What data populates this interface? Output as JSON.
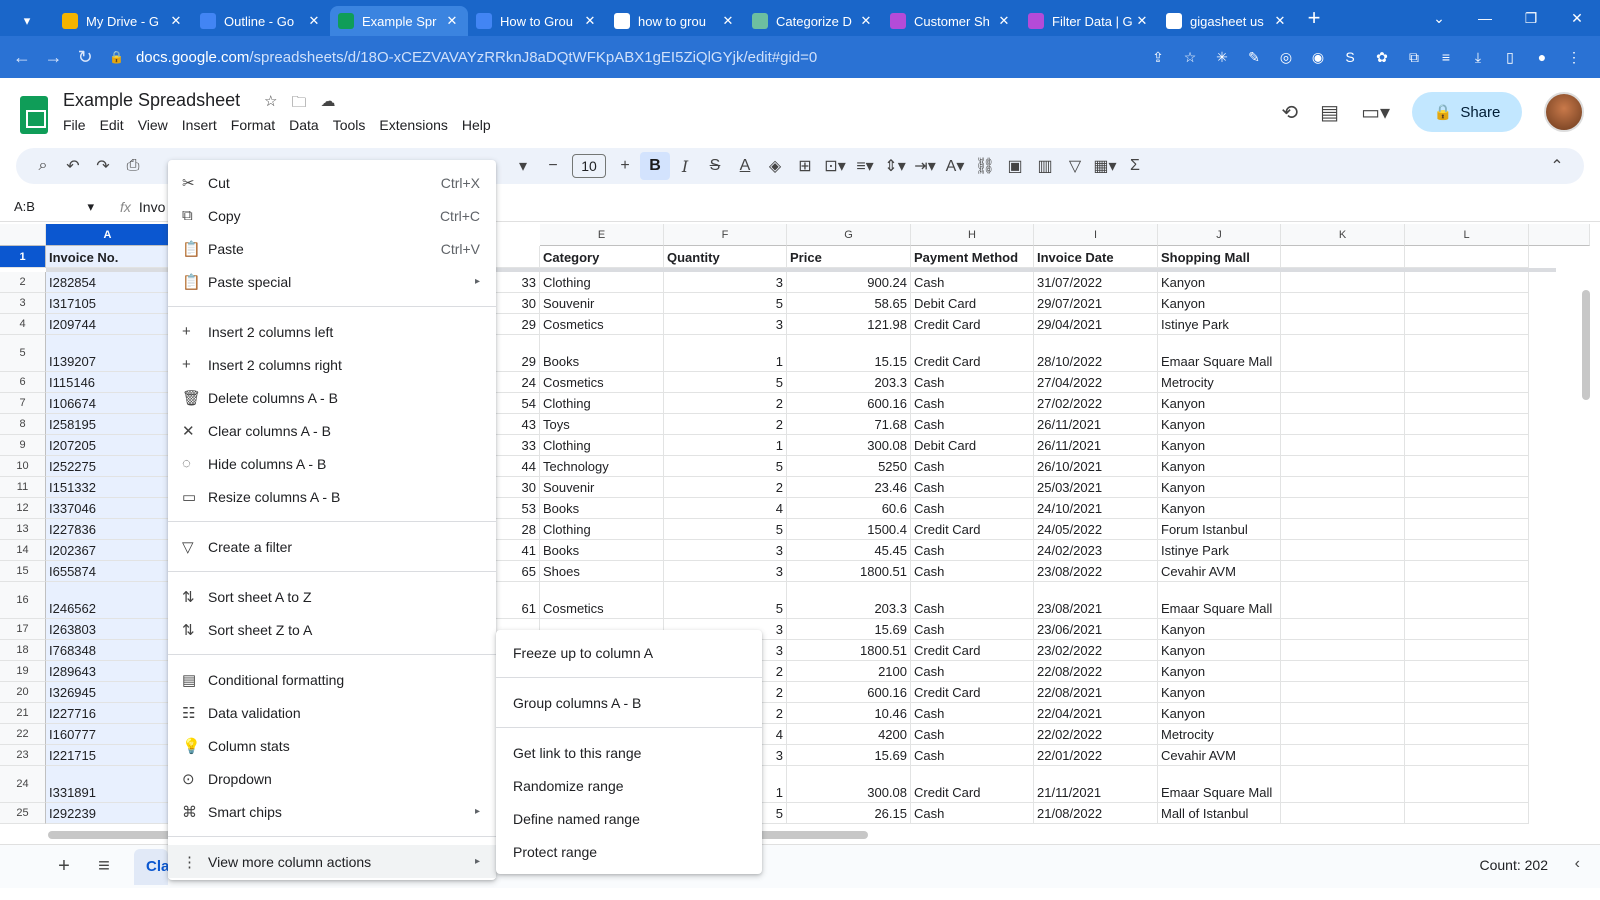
{
  "browser": {
    "tabs": [
      {
        "title": "My Drive - G",
        "color": "#f4b400",
        "icon": "drive-icon"
      },
      {
        "title": "Outline - Go",
        "color": "#4285f4",
        "icon": "docs-icon"
      },
      {
        "title": "Example Spr",
        "color": "#0f9d58",
        "icon": "sheets-icon",
        "active": true
      },
      {
        "title": "How to Grou",
        "color": "#4285f4",
        "icon": "site-icon"
      },
      {
        "title": "how to grou",
        "color": "#ffffff",
        "icon": "google-icon"
      },
      {
        "title": "Categorize D",
        "color": "#6dbfa0",
        "icon": "site-icon"
      },
      {
        "title": "Customer Sh",
        "color": "#b44bd8",
        "icon": "site-icon"
      },
      {
        "title": "Filter Data | G",
        "color": "#b44bd8",
        "icon": "site-icon"
      },
      {
        "title": "gigasheet us",
        "color": "#ffffff",
        "icon": "google-icon"
      }
    ],
    "url_host": "docs.google.com",
    "url_path": "/spreadsheets/d/18O-xCEZVAVAYzRRknJ8aDQtWFKpABX1gEI5ZiQlGYjk/edit#gid=0"
  },
  "app": {
    "title": "Example Spreadsheet",
    "menus": [
      "File",
      "Edit",
      "View",
      "Insert",
      "Format",
      "Data",
      "Tools",
      "Extensions",
      "Help"
    ],
    "share_label": "Share",
    "font_size": "10",
    "name_box": "A:B",
    "formula_value": "Invo"
  },
  "sheet": {
    "columns": [
      {
        "letter": "A",
        "selected": true
      },
      {
        "letter": "E"
      },
      {
        "letter": "F"
      },
      {
        "letter": "G"
      },
      {
        "letter": "H"
      },
      {
        "letter": "I"
      },
      {
        "letter": "J"
      },
      {
        "letter": "K"
      },
      {
        "letter": "L"
      }
    ],
    "header_row": {
      "a": "Invoice No.",
      "d": "",
      "e": "Category",
      "f": "Quantity",
      "g": "Price",
      "h": "Payment Method",
      "i": "Invoice Date",
      "j": "Shopping Mall"
    },
    "rows": [
      {
        "n": "2",
        "a": "I282854",
        "d": "33",
        "e": "Clothing",
        "f": "3",
        "g": "900.24",
        "h": "Cash",
        "i": "31/07/2022",
        "j": "Kanyon"
      },
      {
        "n": "3",
        "a": "I317105",
        "d": "30",
        "e": "Souvenir",
        "f": "5",
        "g": "58.65",
        "h": "Debit Card",
        "i": "29/07/2021",
        "j": "Kanyon"
      },
      {
        "n": "4",
        "a": "I209744",
        "d": "29",
        "e": "Cosmetics",
        "f": "3",
        "g": "121.98",
        "h": "Credit Card",
        "i": "29/04/2021",
        "j": "Istinye Park"
      },
      {
        "n": "5",
        "a": "I139207",
        "d": "29",
        "e": "Books",
        "f": "1",
        "g": "15.15",
        "h": "Credit Card",
        "i": "28/10/2022",
        "j": "Emaar Square Mall",
        "tall": true
      },
      {
        "n": "6",
        "a": "I115146",
        "d": "24",
        "e": "Cosmetics",
        "f": "5",
        "g": "203.3",
        "h": "Cash",
        "i": "27/04/2022",
        "j": "Metrocity"
      },
      {
        "n": "7",
        "a": "I106674",
        "d": "54",
        "e": "Clothing",
        "f": "2",
        "g": "600.16",
        "h": "Cash",
        "i": "27/02/2022",
        "j": "Kanyon"
      },
      {
        "n": "8",
        "a": "I258195",
        "d": "43",
        "e": "Toys",
        "f": "2",
        "g": "71.68",
        "h": "Cash",
        "i": "26/11/2021",
        "j": "Kanyon"
      },
      {
        "n": "9",
        "a": "I207205",
        "d": "33",
        "e": "Clothing",
        "f": "1",
        "g": "300.08",
        "h": "Debit Card",
        "i": "26/11/2021",
        "j": "Kanyon"
      },
      {
        "n": "10",
        "a": "I252275",
        "d": "44",
        "e": "Technology",
        "f": "5",
        "g": "5250",
        "h": "Cash",
        "i": "26/10/2021",
        "j": "Kanyon"
      },
      {
        "n": "11",
        "a": "I151332",
        "d": "30",
        "e": "Souvenir",
        "f": "2",
        "g": "23.46",
        "h": "Cash",
        "i": "25/03/2021",
        "j": "Kanyon"
      },
      {
        "n": "12",
        "a": "I337046",
        "d": "53",
        "e": "Books",
        "f": "4",
        "g": "60.6",
        "h": "Cash",
        "i": "24/10/2021",
        "j": "Kanyon"
      },
      {
        "n": "13",
        "a": "I227836",
        "d": "28",
        "e": "Clothing",
        "f": "5",
        "g": "1500.4",
        "h": "Credit Card",
        "i": "24/05/2022",
        "j": "Forum Istanbul"
      },
      {
        "n": "14",
        "a": "I202367",
        "d": "41",
        "e": "Books",
        "f": "3",
        "g": "45.45",
        "h": "Cash",
        "i": "24/02/2023",
        "j": "Istinye Park"
      },
      {
        "n": "15",
        "a": "I655874",
        "d": "65",
        "e": "Shoes",
        "f": "3",
        "g": "1800.51",
        "h": "Cash",
        "i": "23/08/2022",
        "j": "Cevahir AVM"
      },
      {
        "n": "16",
        "a": "I246562",
        "d": "61",
        "e": "Cosmetics",
        "f": "5",
        "g": "203.3",
        "h": "Cash",
        "i": "23/08/2021",
        "j": "Emaar Square Mall",
        "tall": true
      },
      {
        "n": "17",
        "a": "I263803",
        "d": "",
        "e": "",
        "f": "3",
        "g": "15.69",
        "h": "Cash",
        "i": "23/06/2021",
        "j": "Kanyon"
      },
      {
        "n": "18",
        "a": "I768348",
        "d": "",
        "e": "",
        "f": "3",
        "g": "1800.51",
        "h": "Credit Card",
        "i": "23/02/2022",
        "j": "Kanyon"
      },
      {
        "n": "19",
        "a": "I289643",
        "d": "",
        "e": "",
        "f": "2",
        "g": "2100",
        "h": "Cash",
        "i": "22/08/2022",
        "j": "Kanyon"
      },
      {
        "n": "20",
        "a": "I326945",
        "d": "",
        "e": "",
        "f": "2",
        "g": "600.16",
        "h": "Credit Card",
        "i": "22/08/2021",
        "j": "Kanyon"
      },
      {
        "n": "21",
        "a": "I227716",
        "d": "",
        "e": "",
        "f": "2",
        "g": "10.46",
        "h": "Cash",
        "i": "22/04/2021",
        "j": "Kanyon"
      },
      {
        "n": "22",
        "a": "I160777",
        "d": "",
        "e": "",
        "f": "4",
        "g": "4200",
        "h": "Cash",
        "i": "22/02/2022",
        "j": "Metrocity"
      },
      {
        "n": "23",
        "a": "I221715",
        "d": "",
        "e": "",
        "f": "3",
        "g": "15.69",
        "h": "Cash",
        "i": "22/01/2022",
        "j": "Cevahir AVM"
      },
      {
        "n": "24",
        "a": "I331891",
        "d": "",
        "e": "",
        "f": "1",
        "g": "300.08",
        "h": "Credit Card",
        "i": "21/11/2021",
        "j": "Emaar Square Mall",
        "tall": true
      },
      {
        "n": "25",
        "a": "I292239",
        "d": "",
        "e": "",
        "f": "5",
        "g": "26.15",
        "h": "Cash",
        "i": "21/08/2022",
        "j": "Mall of Istanbul"
      }
    ],
    "sheet_tab": "Cla",
    "status": "Count: 202"
  },
  "context_menu": {
    "items": [
      {
        "icon": "✂",
        "icon_name": "cut-icon",
        "label": "Cut",
        "shortcut": "Ctrl+X"
      },
      {
        "icon": "⧉",
        "icon_name": "copy-icon",
        "label": "Copy",
        "shortcut": "Ctrl+C"
      },
      {
        "icon": "📋",
        "icon_name": "paste-icon",
        "label": "Paste",
        "shortcut": "Ctrl+V"
      },
      {
        "icon": "📋",
        "icon_name": "paste-special-icon",
        "label": "Paste special",
        "submenu": true
      },
      {
        "sep": true
      },
      {
        "icon": "+",
        "icon_name": "plus-icon",
        "label": "Insert 2 columns left"
      },
      {
        "icon": "+",
        "icon_name": "plus-icon",
        "label": "Insert 2 columns right"
      },
      {
        "icon": "🗑",
        "icon_name": "trash-icon",
        "label": "Delete columns A - B"
      },
      {
        "icon": "✕",
        "icon_name": "clear-icon",
        "label": "Clear columns A - B"
      },
      {
        "icon": "◌",
        "icon_name": "hide-icon",
        "label": "Hide columns A - B"
      },
      {
        "icon": "▭",
        "icon_name": "resize-icon",
        "label": "Resize columns A - B"
      },
      {
        "sep": true
      },
      {
        "icon": "▽",
        "icon_name": "filter-icon",
        "label": "Create a filter"
      },
      {
        "sep": true
      },
      {
        "icon": "⇅",
        "icon_name": "sort-az-icon",
        "label": "Sort sheet A to Z"
      },
      {
        "icon": "⇅",
        "icon_name": "sort-za-icon",
        "label": "Sort sheet Z to A"
      },
      {
        "sep": true
      },
      {
        "icon": "▤",
        "icon_name": "conditional-format-icon",
        "label": "Conditional formatting"
      },
      {
        "icon": "☷",
        "icon_name": "data-validation-icon",
        "label": "Data validation"
      },
      {
        "icon": "💡",
        "icon_name": "column-stats-icon",
        "label": "Column stats"
      },
      {
        "icon": "⊙",
        "icon_name": "dropdown-icon",
        "label": "Dropdown"
      },
      {
        "icon": "⌘",
        "icon_name": "smart-chips-icon",
        "label": "Smart chips",
        "submenu": true
      },
      {
        "sep": true
      },
      {
        "icon": "⋮",
        "icon_name": "more-vert-icon",
        "label": "View more column actions",
        "submenu": true,
        "highlight": true
      }
    ]
  },
  "sub_menu": {
    "items": [
      {
        "label": "Freeze up to column A"
      },
      {
        "sep": true
      },
      {
        "label": "Group columns A - B"
      },
      {
        "sep": true
      },
      {
        "label": "Get link to this range"
      },
      {
        "label": "Randomize range"
      },
      {
        "label": "Define named range"
      },
      {
        "label": "Protect range"
      }
    ]
  }
}
